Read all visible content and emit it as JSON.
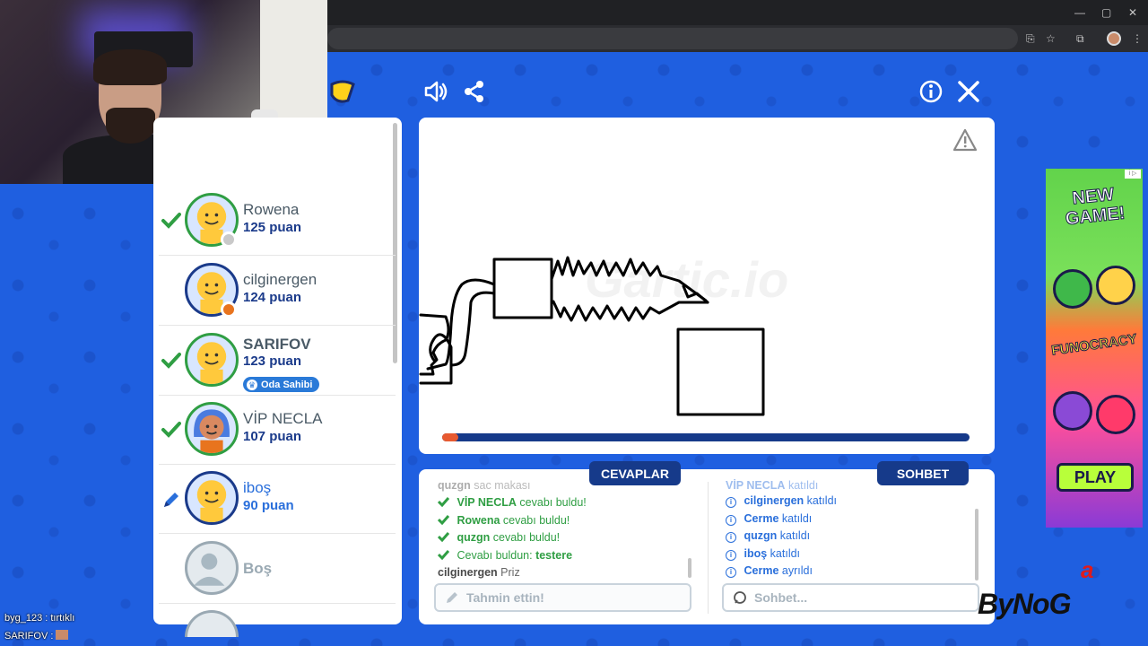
{
  "browser": {
    "icons": [
      "minimize-icon",
      "restore-icon",
      "close-icon",
      "cast-icon",
      "bookmark-star-icon",
      "extensions-icon",
      "profile-icon",
      "menu-icon"
    ]
  },
  "toolbar": {
    "icons": [
      "sound-icon",
      "share-icon",
      "info-icon",
      "close-icon"
    ]
  },
  "players": [
    {
      "name": "Rowena",
      "score": "125 puan",
      "guessed": true,
      "status_color": "#c9c9c9"
    },
    {
      "name": "cilginergen",
      "score": "124 puan",
      "guessed": false,
      "status_color": "#e8741e"
    },
    {
      "name": "SARIFOV",
      "score": "123 puan",
      "guessed": true,
      "badge": "Oda Sahibi"
    },
    {
      "name": "VİP NECLA",
      "score": "107 puan",
      "guessed": true
    },
    {
      "name": "iboş",
      "score": "90 puan",
      "drawing": true
    },
    {
      "name": "Boş"
    }
  ],
  "canvas": {
    "progress": 0.03,
    "progress_color": "#e85a30"
  },
  "answers": {
    "tab_label": "CEVAPLAR",
    "messages": [
      {
        "who": "quzgn",
        "text": "sac makası",
        "faded": true
      },
      {
        "who": "VİP NECLA",
        "text": "cevabı buldu!"
      },
      {
        "who": "Rowena",
        "text": "cevabı buldu!"
      },
      {
        "who": "quzgn",
        "text": "cevabı buldu!"
      },
      {
        "who": "Cevabı buldun:",
        "text": "testere",
        "self": true
      },
      {
        "who": "cilginergen",
        "text": "Priz",
        "plain": true
      }
    ],
    "input_placeholder": "Tahmin ettin!"
  },
  "chat": {
    "tab_label": "SOHBET",
    "messages": [
      {
        "who": "VİP NECLA",
        "text": "katıldı",
        "faded": true
      },
      {
        "who": "cilginergen",
        "text": "katıldı"
      },
      {
        "who": "Cerme",
        "text": "katıldı"
      },
      {
        "who": "quzgn",
        "text": "katıldı"
      },
      {
        "who": "iboş",
        "text": "katıldı"
      },
      {
        "who": "Cerme",
        "text": "ayrıldı"
      }
    ],
    "input_placeholder": "Sohbet..."
  },
  "ad": {
    "title": "NEW GAME!",
    "brand": "FUNOCRACY",
    "cta": "PLAY",
    "corner": "i ▷"
  },
  "stream_overlay": {
    "line1": "byg_123 : tırtıklı",
    "line2": "SARIFOV :",
    "watermark": "ByNoG",
    "watermark_accent": "a"
  }
}
